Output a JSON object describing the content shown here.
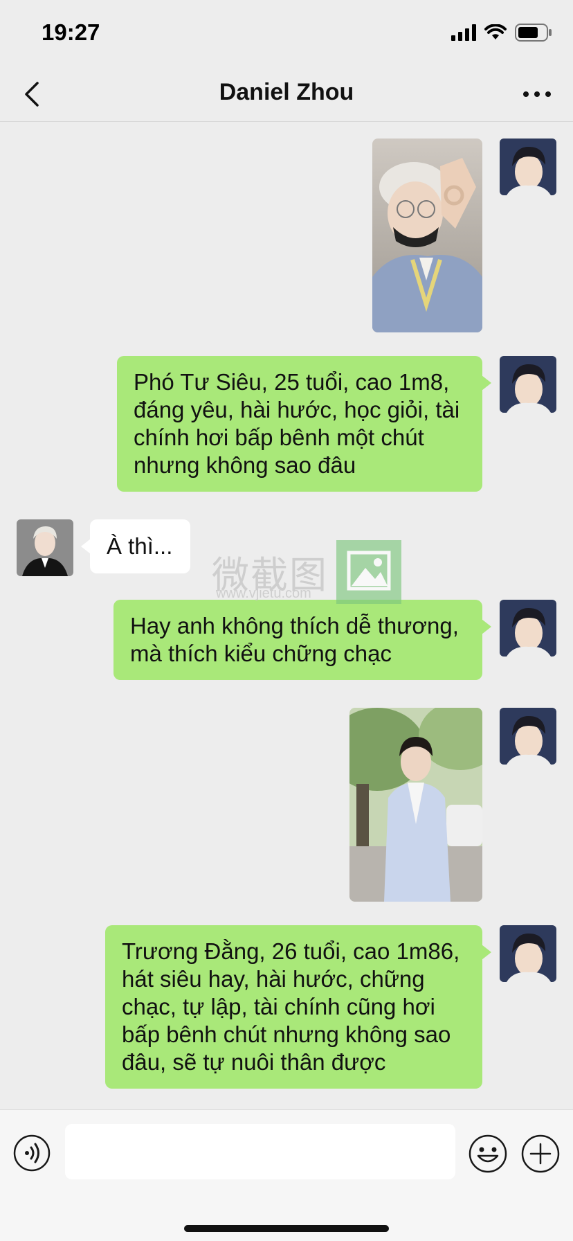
{
  "status_bar": {
    "time": "19:27"
  },
  "header": {
    "title": "Daniel Zhou"
  },
  "messages": [
    {
      "id": "m1",
      "sender": "me",
      "type": "image",
      "image_desc": "Selfie of young man with glasses making OK hand sign"
    },
    {
      "id": "m2",
      "sender": "me",
      "type": "text",
      "text": "Phó Tư Siêu, 25 tuổi, cao 1m8, đáng yêu, hài hước, học giỏi, tài chính hơi bấp bênh một chút nhưng không sao đâu"
    },
    {
      "id": "m3",
      "sender": "them",
      "type": "text",
      "text": "À thì..."
    },
    {
      "id": "m4",
      "sender": "me",
      "type": "text",
      "text": "Hay anh không thích dễ thương, mà thích kiểu chững chạc"
    },
    {
      "id": "m5",
      "sender": "me",
      "type": "image",
      "image_desc": "Young man in light blue suit standing outdoors"
    },
    {
      "id": "m6",
      "sender": "me",
      "type": "text",
      "text": "Trương Đằng, 26 tuổi, cao 1m86, hát siêu hay, hài hước, chững chạc, tự lập, tài chính cũng hơi bấp bênh chút nhưng không sao đâu, sẽ tự nuôi thân được"
    }
  ],
  "watermark": {
    "chinese": "微截图",
    "url": "www.vjietu.com"
  },
  "input": {
    "value": "",
    "placeholder": ""
  },
  "colors": {
    "my_bubble": "#A9E879",
    "their_bubble": "#FFFFFF",
    "background": "#EDEDED"
  }
}
